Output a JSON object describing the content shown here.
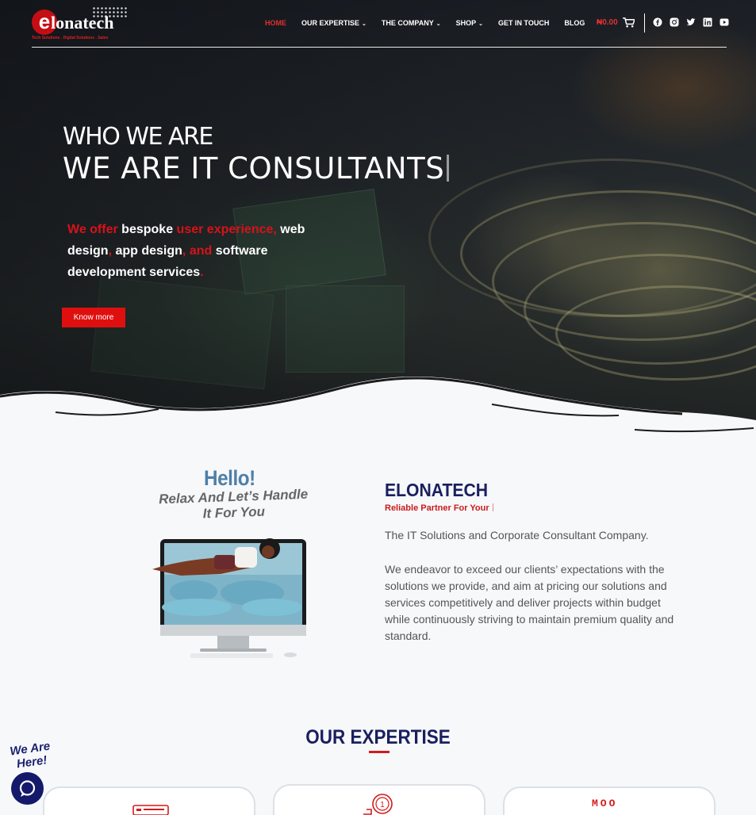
{
  "brand": {
    "logo_letter": "e",
    "logo_text": "lonatech",
    "tagline": "Tech Solutions . Digital Solutions . Sales"
  },
  "nav": {
    "items": [
      {
        "label": "HOME",
        "active": true,
        "dropdown": false
      },
      {
        "label": "OUR EXPERTISE",
        "active": false,
        "dropdown": true
      },
      {
        "label": "THE COMPANY",
        "active": false,
        "dropdown": true
      },
      {
        "label": "SHOP",
        "active": false,
        "dropdown": true
      },
      {
        "label": "GET IN TOUCH",
        "active": false,
        "dropdown": false
      },
      {
        "label": "BLOG",
        "active": false,
        "dropdown": false
      }
    ],
    "cart_amount": "₦0.00",
    "cart_icon": "cart-icon",
    "socials": [
      "facebook-icon",
      "instagram-icon",
      "twitter-icon",
      "linkedin-icon",
      "youtube-icon"
    ]
  },
  "hero": {
    "kicker": "WHO WE ARE",
    "title": "WE ARE IT CONSULTANTS",
    "copy": {
      "w1": "We offer",
      "w2": "bespoke",
      "w3": "user experience,",
      "w4": "web design",
      "w5": ",",
      "w6": "app design",
      "w7": ",",
      "w8": "and",
      "w9": "software development services",
      "w10": "."
    },
    "cta_label": "Know more"
  },
  "about": {
    "hello": "Hello!",
    "relax_line1": "Relax And Let’s Handle",
    "relax_line2": "It For You",
    "title": "ELONATECH",
    "subtitle": "Reliable Partner For Your",
    "p1": "The IT Solutions and Corporate Consultant Company.",
    "p2": "We endeavor to exceed our clients’ expectations with the solutions we provide, and aim at pricing our solutions and services competitively and deliver projects within budget while continuously striving to maintain premium quality and standard."
  },
  "expertise": {
    "title": "OUR EXPERTISE",
    "card3_icon_text": "MOO"
  },
  "chat": {
    "badge": "We Are Here!",
    "icon": "chat-icon"
  },
  "colors": {
    "accent_red": "#d8121a",
    "navy": "#1a1f5e",
    "hello_blue": "#4f7fa6"
  }
}
